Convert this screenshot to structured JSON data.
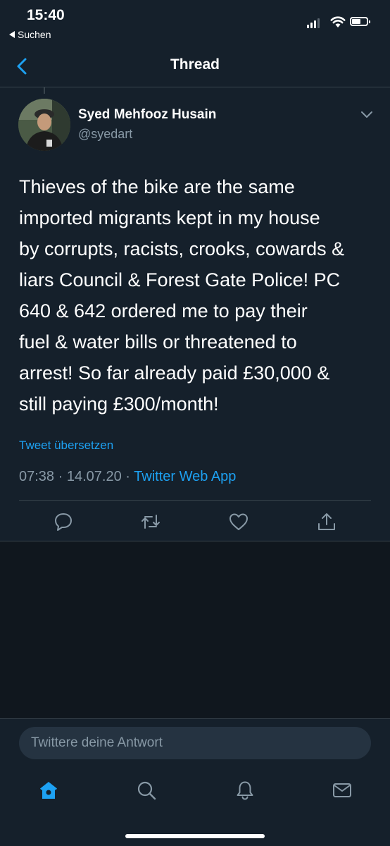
{
  "status_bar": {
    "time": "15:40",
    "back_label": "Suchen"
  },
  "header": {
    "title": "Thread"
  },
  "tweet": {
    "author_name": "Syed Mehfooz Husain",
    "author_handle": "@syedart",
    "text": "Thieves of the bike are the same\nimported migrants kept in my house\nby corrupts, racists, crooks, cowards &\nliars Council & Forest Gate Police! PC\n640 & 642 ordered me to pay their\nfuel & water bills or threatened to\narrest! So far already paid £30,000 &\nstill paying £300/month!",
    "translate_label": "Tweet übersetzen",
    "time": "07:38",
    "date": "14.07.20",
    "separator": "·",
    "source": "Twitter Web App"
  },
  "actions": [
    "reply-icon",
    "retweet-icon",
    "like-icon",
    "share-icon"
  ],
  "composer": {
    "placeholder": "Twittere deine Antwort"
  },
  "tabbar": {
    "items": [
      "home-icon",
      "search-icon",
      "notifications-icon",
      "messages-icon"
    ],
    "active": "home-icon"
  },
  "colors": {
    "background": "#15202b",
    "accent": "#1da1f2",
    "secondary_text": "#8899a6",
    "divider": "#38444d"
  }
}
